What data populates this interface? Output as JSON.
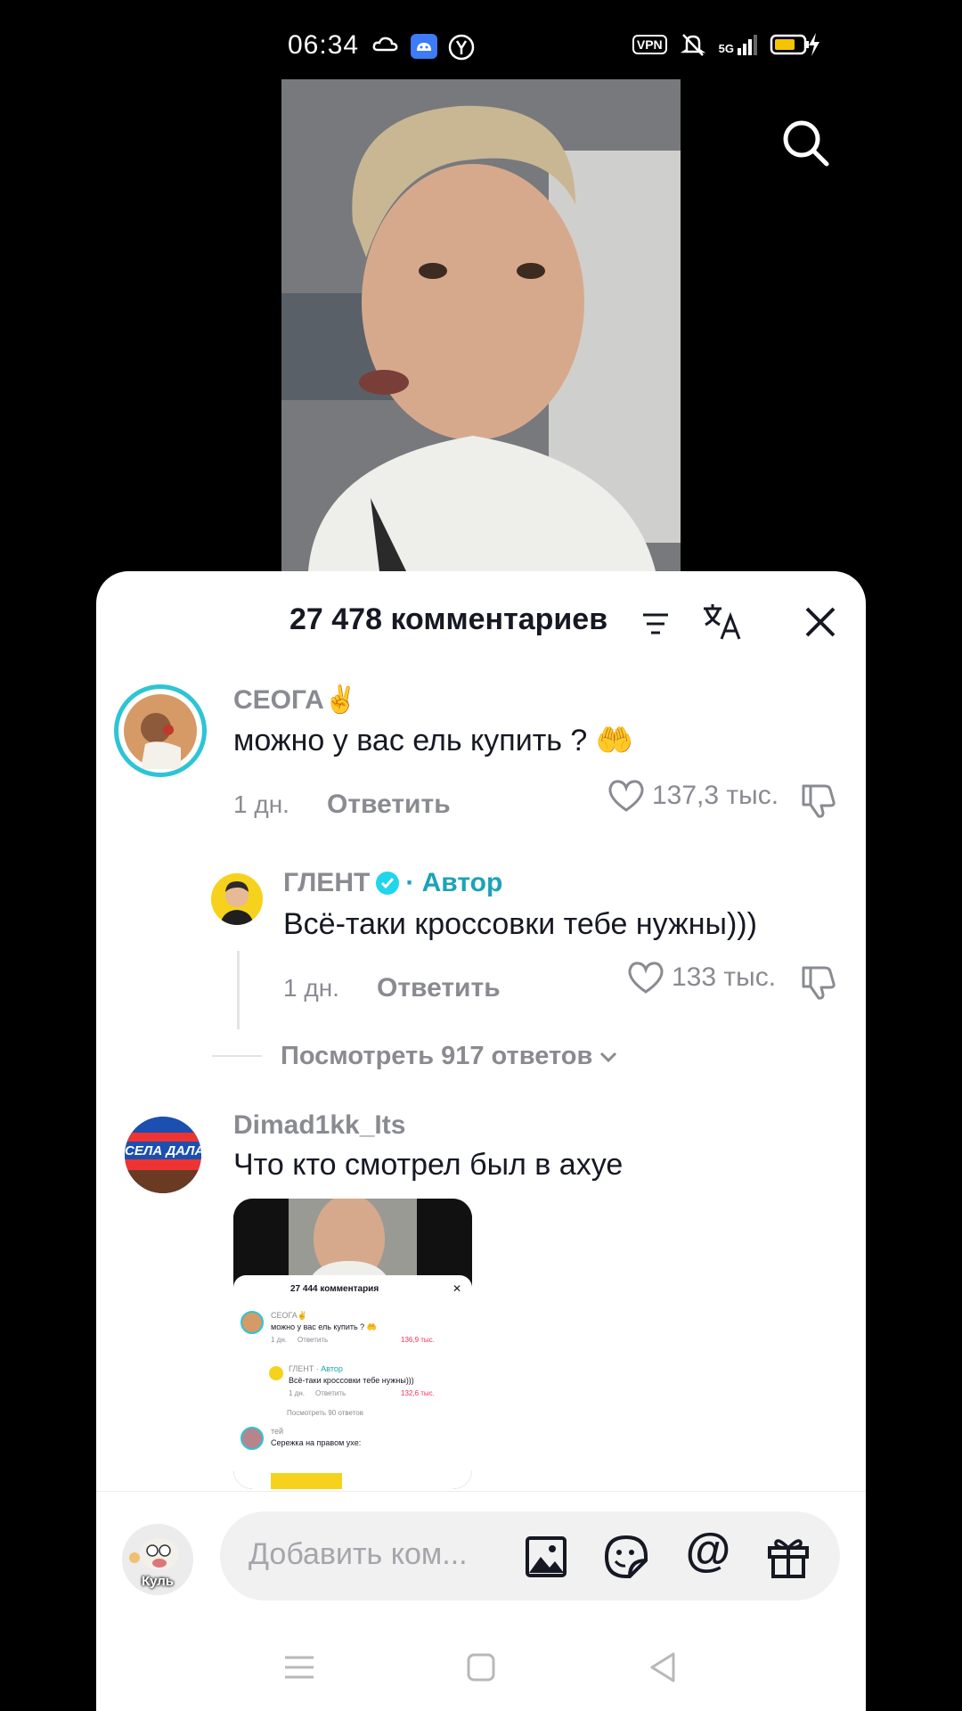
{
  "status_bar": {
    "time": "06:34",
    "icons": [
      "cloud-icon",
      "android-icon",
      "yandex-icon",
      "vpn-icon",
      "silent-icon",
      "signal-5g-icon",
      "battery-charging-icon"
    ],
    "vpn_label": "VPN",
    "network_label": "5G"
  },
  "video": {
    "search_icon": "search-icon"
  },
  "comments_sheet": {
    "title": "27 478 комментариев",
    "icons": [
      "filter-icon",
      "translate-icon",
      "close-icon"
    ],
    "comments": [
      {
        "username": "СЕОГА✌️",
        "text": "можно у вас ель купить ? 🤲",
        "age": "1 дн.",
        "reply_label": "Ответить",
        "likes": "137,3 тыс."
      },
      {
        "username": "ГЛЕНТ",
        "verified": true,
        "author_badge": "· Автор",
        "text": "Всё-таки кроссовки тебе нужны)))",
        "age": "1 дн.",
        "reply_label": "Ответить",
        "likes": "133 тыс."
      },
      {
        "username": "Dimad1kk_Its",
        "text": "Что кто смотрел был в ахуе",
        "avatar_text": "СЕЛА ДАЛА"
      }
    ],
    "view_replies": "Посмотреть 917 ответов",
    "attachment_preview": {
      "title": "27 444 комментария",
      "c1_user": "СЕОГА✌️",
      "c1_text": "можно у вас ель купить ? 🤲",
      "c1_age": "1 дн.",
      "c1_reply": "Ответить",
      "c1_likes": "136,9 тыс.",
      "c2_user": "ГЛЕНТ",
      "c2_badge": "· Автор",
      "c2_text": "Всё-таки кроссовки тебе нужны)))",
      "c2_age": "1 дн.",
      "c2_reply": "Ответить",
      "c2_likes": "132,6 тыс.",
      "more": "Посмотреть 90 ответов",
      "c3_user": "тей",
      "c3_text": "Сережка на правом ухе:"
    }
  },
  "composer": {
    "placeholder": "Добавить ком...",
    "avatar_caption": "Куль",
    "icons": [
      "image-icon",
      "emoji-icon",
      "mention-icon",
      "gift-icon"
    ],
    "mention_glyph": "@"
  },
  "nav_bar": {
    "icons": [
      "menu-icon",
      "home-icon",
      "back-icon"
    ]
  },
  "colors": {
    "accent_teal": "#1ba3b8",
    "verified_blue": "#20d5ec",
    "muted": "#8a8b91",
    "like_red": "#fe2c55"
  }
}
